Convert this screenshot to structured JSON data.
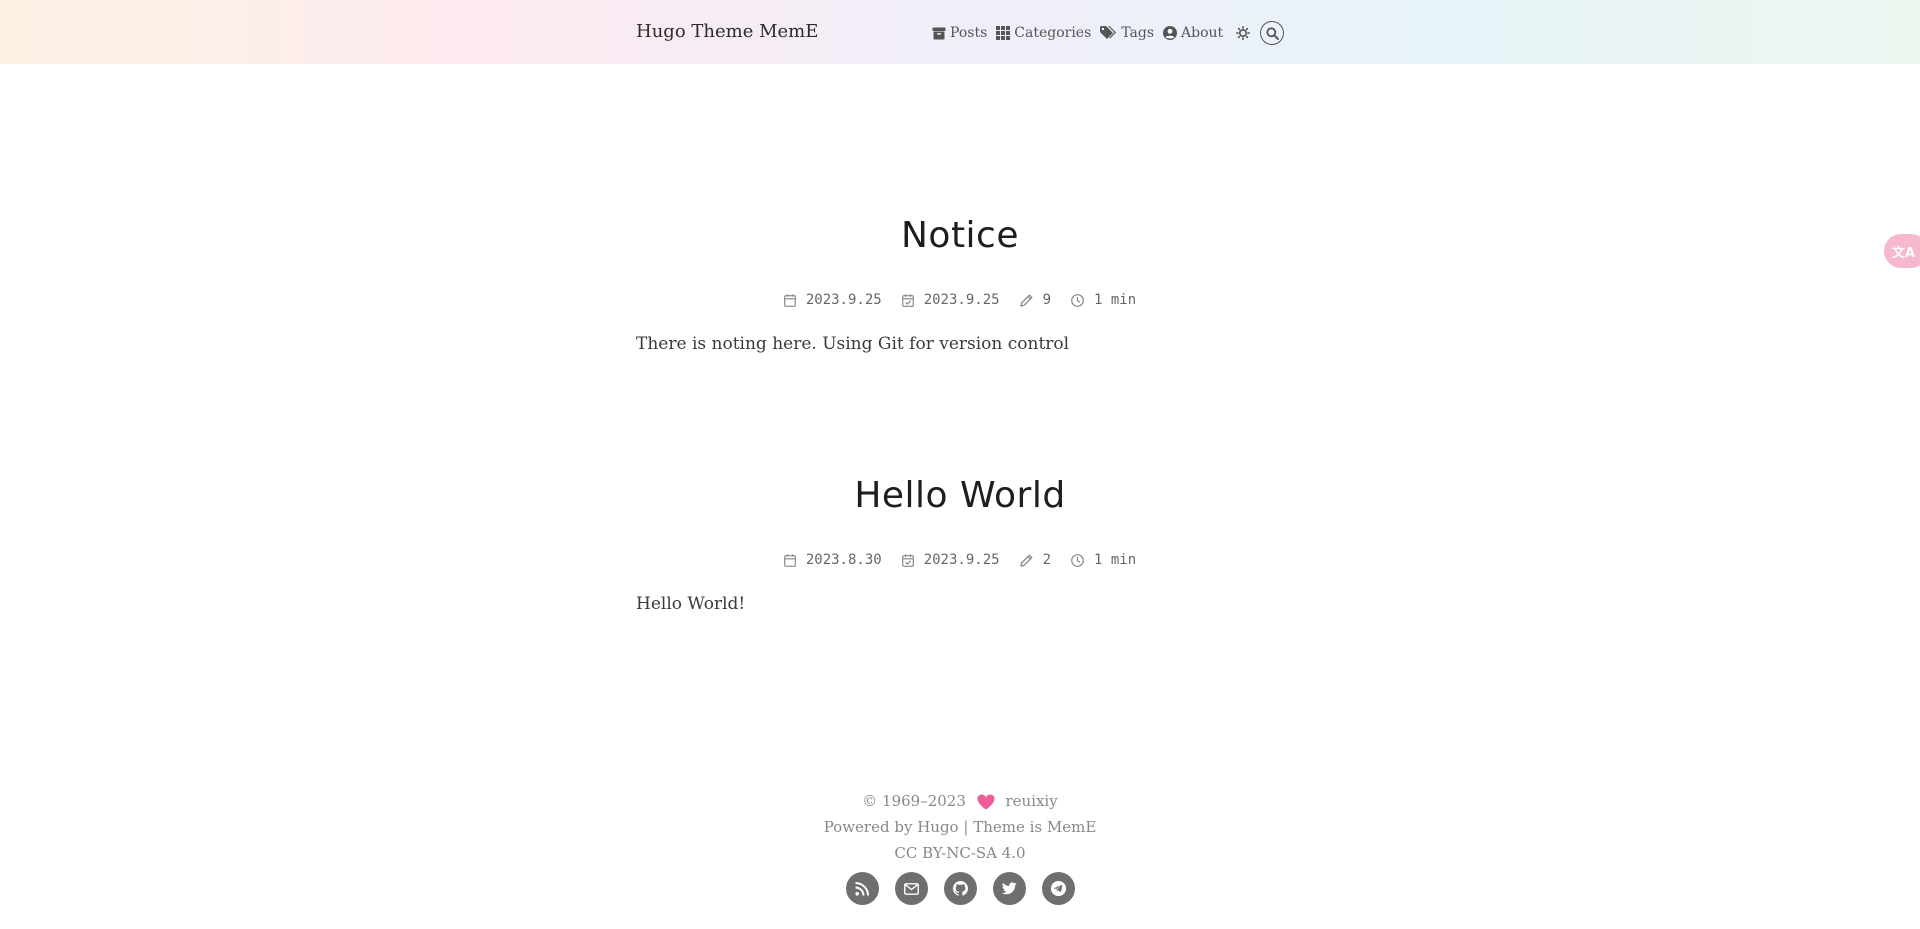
{
  "header": {
    "brand": "Hugo Theme MemE",
    "nav": [
      {
        "label": "Posts",
        "icon": "archive-icon"
      },
      {
        "label": "Categories",
        "icon": "grid-icon"
      },
      {
        "label": "Tags",
        "icon": "tags-icon"
      },
      {
        "label": "About",
        "icon": "user-circle-icon"
      }
    ],
    "theme_toggle_icon": "sun-icon",
    "search_icon": "search-icon"
  },
  "translate_tab": {
    "icon": "translate-icon",
    "text": "文A"
  },
  "posts": [
    {
      "title": "Notice",
      "published": "2023.9.25",
      "updated": "2023.9.25",
      "words": "9",
      "reading_time": "1 min",
      "summary": "There is noting here. Using Git for version control"
    },
    {
      "title": "Hello World",
      "published": "2023.8.30",
      "updated": "2023.9.25",
      "words": "2",
      "reading_time": "1 min",
      "summary": "Hello World!"
    }
  ],
  "footer": {
    "copyright": "© 1969–2023",
    "author": "reuixiy",
    "powered_prefix": "Powered by",
    "powered_hugo": "Hugo",
    "separator": "|",
    "theme_prefix": "Theme is",
    "theme_name": "MemE",
    "license": "CC BY-NC-SA 4.0",
    "heart_color": "#ef5c9a",
    "social": [
      "rss-icon",
      "email-icon",
      "github-icon",
      "twitter-icon",
      "telegram-icon"
    ]
  }
}
